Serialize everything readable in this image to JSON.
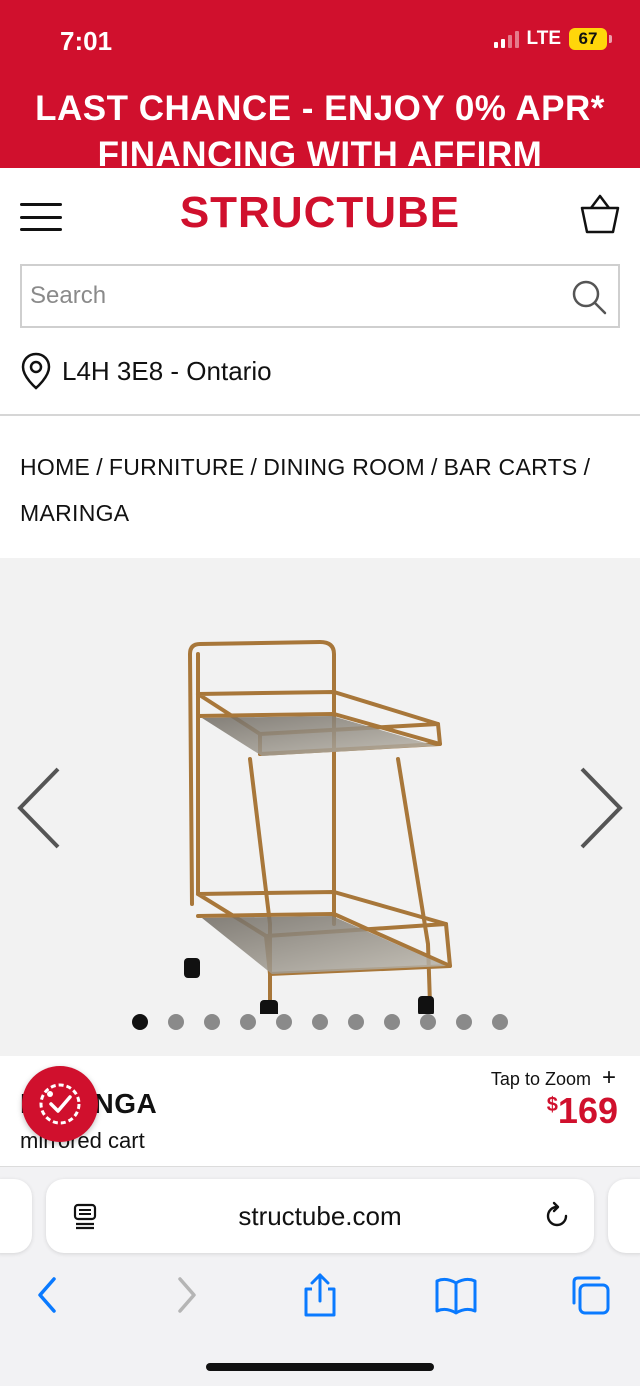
{
  "status_bar": {
    "time": "7:01",
    "network": "LTE",
    "battery": "67"
  },
  "promo_banner": {
    "line1": "LAST CHANCE - ENJOY 0% APR*",
    "line2": "FINANCING WITH AFFIRM"
  },
  "header": {
    "logo": "STRUCTUBE",
    "search_placeholder": "Search",
    "location": "L4H 3E8 - Ontario"
  },
  "breadcrumb": {
    "items": [
      "HOME",
      "FURNITURE",
      "DINING ROOM",
      "BAR CARTS",
      "MARINGA"
    ],
    "separator": "/"
  },
  "gallery": {
    "image_count": 11,
    "active_index": 0
  },
  "product": {
    "name": "MARINGA",
    "subtitle": "mirrored cart",
    "zoom_label": "Tap to Zoom",
    "zoom_symbol": "+",
    "currency_symbol": "$",
    "price": "169"
  },
  "browser": {
    "url": "structube.com"
  },
  "colors": {
    "brand_red": "#d0102d",
    "ios_blue": "#0a7aff",
    "gallery_bg": "#f2f2f2"
  }
}
